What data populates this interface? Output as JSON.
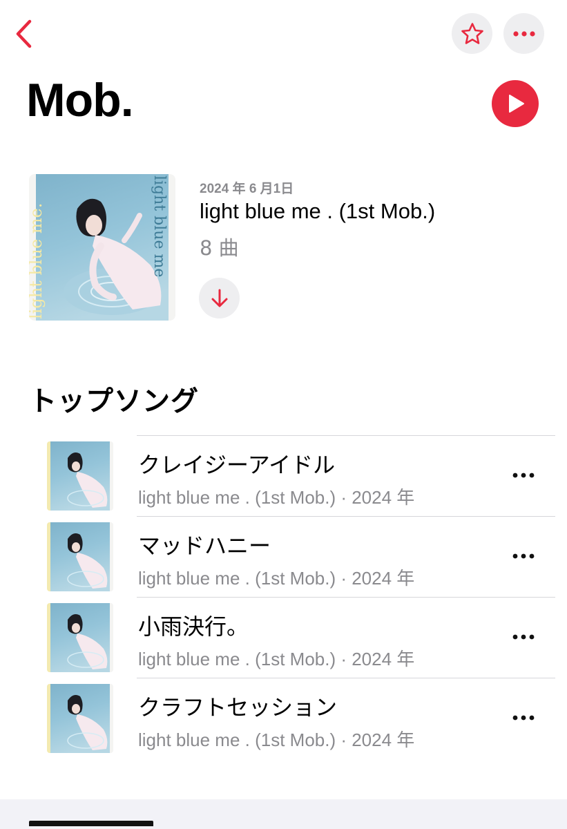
{
  "colors": {
    "accent": "#e8293f",
    "secondary_text": "#8a8a8e",
    "button_bg": "#eeeef0"
  },
  "nav": {
    "back_icon": "chevron-left-icon",
    "favorite_icon": "star-icon",
    "more_icon": "ellipsis-icon"
  },
  "artist": {
    "name": "Mob.",
    "play_icon": "play-icon"
  },
  "latest_release": {
    "date": "2024 年 6 月1日",
    "title": "light blue me . (1st Mob.)",
    "track_count": "8 曲",
    "artwork_text": "light blue me",
    "download_icon": "download-arrow-icon"
  },
  "top_songs": {
    "heading": "トップソング",
    "songs": [
      {
        "title": "クレイジーアイドル",
        "subtitle": "light blue me . (1st Mob.) · 2024 年"
      },
      {
        "title": "マッドハニー",
        "subtitle": "light blue me . (1st Mob.) · 2024 年"
      },
      {
        "title": "小雨決行。",
        "subtitle": "light blue me . (1st Mob.) · 2024 年"
      },
      {
        "title": "クラフトセッション",
        "subtitle": "light blue me . (1st Mob.) · 2024 年"
      }
    ]
  }
}
